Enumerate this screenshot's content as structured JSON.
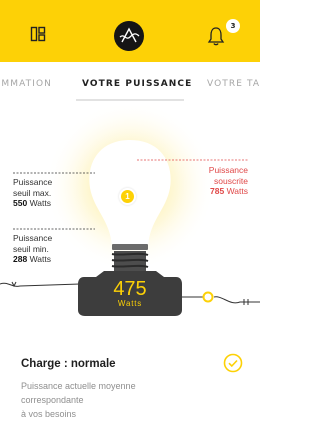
{
  "header": {
    "notification_count": "3",
    "accent_color": "#fdd106"
  },
  "icons": {
    "left": "grid-layout-icon",
    "center": "logo-icon",
    "right": "bell-icon"
  },
  "tabs": [
    {
      "label": "CONSOMMATION",
      "active": false
    },
    {
      "label": "VOTRE PUISSANCE",
      "active": true
    },
    {
      "label": "VOTRE TARIF",
      "active": false
    }
  ],
  "illustration": {
    "max_power": {
      "line1": "Puissance",
      "line2": "seuil max.",
      "value": "550",
      "unit": "Watts"
    },
    "min_power": {
      "line1": "Puissance",
      "line2": "seuil min.",
      "value": "288",
      "unit": "Watts"
    },
    "subscribed_power": {
      "line1": "Puissance",
      "line2": "souscrite",
      "value": "785",
      "unit": "Watts",
      "color": "#e04747"
    },
    "current_power": {
      "value": "475",
      "unit": "Watts"
    },
    "marker_label": "1"
  },
  "status": {
    "title": "Charge : normale",
    "description_lines": [
      "Puissance actuelle moyenne",
      "correspondante",
      "à vos besoins"
    ]
  }
}
